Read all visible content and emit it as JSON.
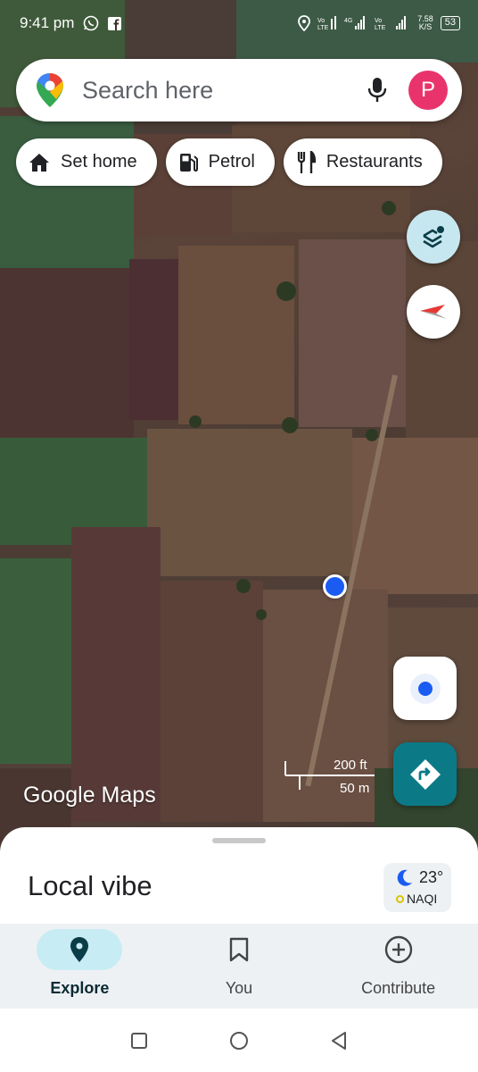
{
  "status_bar": {
    "time": "9:41 pm",
    "network_speed": "7.58\nK/S",
    "battery": "53"
  },
  "search": {
    "placeholder": "Search here",
    "avatar_letter": "P"
  },
  "chips": [
    {
      "label": "Set home",
      "icon": "home-icon"
    },
    {
      "label": "Petrol",
      "icon": "fuel-icon"
    },
    {
      "label": "Restaurants",
      "icon": "restaurant-icon"
    }
  ],
  "map": {
    "scale_ft": "200 ft",
    "scale_m": "50 m",
    "brand": "Google Maps"
  },
  "sheet": {
    "title": "Local vibe",
    "weather": {
      "temp": "23°",
      "aqi": "NAQI"
    }
  },
  "bottom_nav": [
    {
      "label": "Explore",
      "icon": "location-pin-icon",
      "active": true
    },
    {
      "label": "You",
      "icon": "bookmark-icon",
      "active": false
    },
    {
      "label": "Contribute",
      "icon": "add-circle-icon",
      "active": false
    }
  ],
  "colors": {
    "accent_teal": "#0b7a86",
    "avatar": "#e8336d",
    "my_location": "#1a5cf2"
  }
}
